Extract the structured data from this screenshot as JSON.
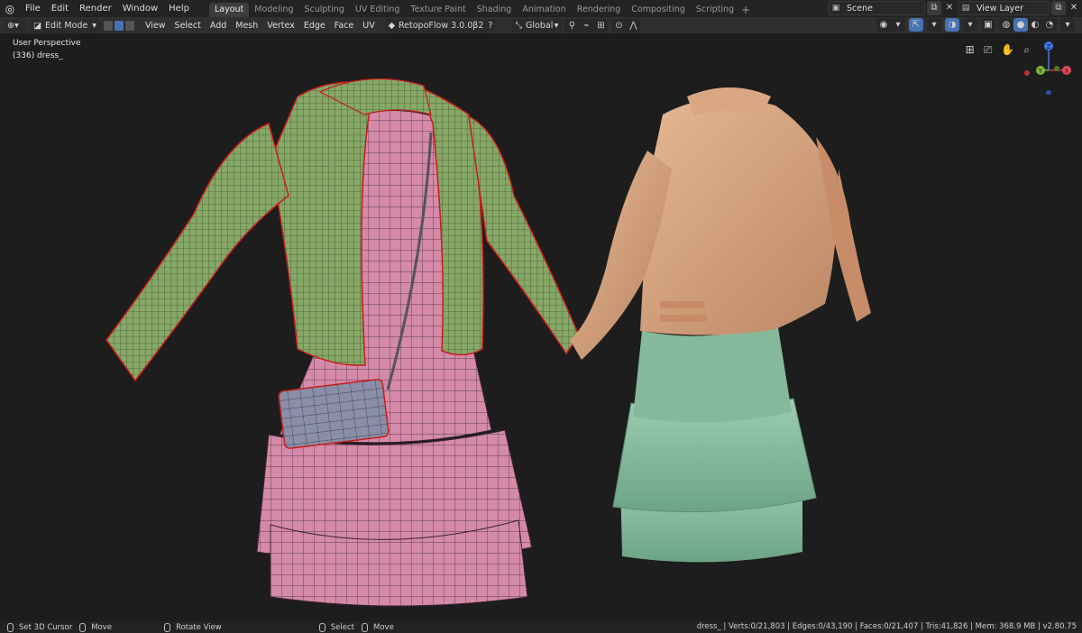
{
  "menu": {
    "items": [
      "File",
      "Edit",
      "Render",
      "Window",
      "Help"
    ]
  },
  "workspaces": [
    "Layout",
    "Modeling",
    "Sculpting",
    "UV Editing",
    "Texture Paint",
    "Shading",
    "Animation",
    "Rendering",
    "Compositing",
    "Scripting"
  ],
  "workspace_add": "+",
  "scene": {
    "label": "Scene"
  },
  "view_layer": {
    "label": "View Layer"
  },
  "header": {
    "mode": "Edit Mode",
    "menus": [
      "View",
      "Select",
      "Add",
      "Mesh",
      "Vertex",
      "Edge",
      "Face",
      "UV"
    ],
    "addon": "RetopoFlow 3.0.0β2",
    "orientation": "Global"
  },
  "viewport": {
    "perspective": "User Perspective",
    "object": "(336) dress_"
  },
  "gizmo": {
    "z": "Z",
    "y": "Y",
    "x": "X"
  },
  "statusbar": {
    "left": [
      {
        "label": "Set 3D Cursor"
      },
      {
        "label": "Move"
      },
      {
        "label": "Rotate View"
      },
      {
        "label": "Select"
      },
      {
        "label": "Move"
      }
    ],
    "stats": "dress_ | Verts:0/21,803 | Edges:0/43,190 | Faces:0/21,407 | Tris:41,826 | Mem: 368.9 MB | v2.80.75"
  },
  "colors": {
    "jacket_wire": "#86a866",
    "dress_wire": "#d48aa8",
    "jacket_solid": "#d8a27e",
    "skirt_solid": "#8dc0a4",
    "bag": "#8a8ea8",
    "seam": "#c81c1c"
  }
}
